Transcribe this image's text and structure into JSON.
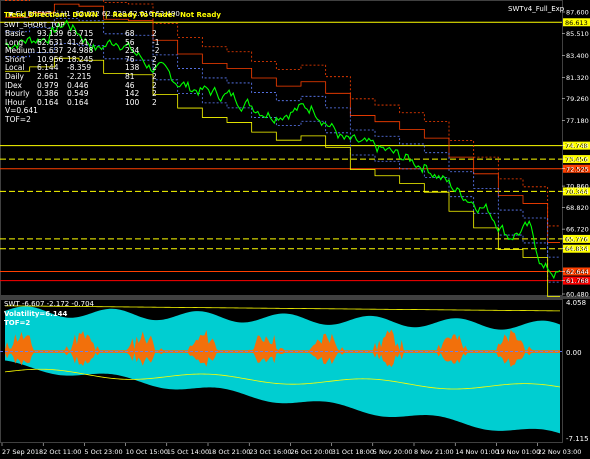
{
  "header": {
    "symbol_line": "CL_BRENT.oi,H1  62.022 62.528 62.016 62.490",
    "trend_line": "Trend Direction:  DOWN   |  Ready To Trade:  Not Ready",
    "indicator_name": "SWTv4_Full_Exp",
    "overlay_title": "SWT_SHORT_TOP"
  },
  "info_table": [
    {
      "label": "Basic",
      "v1": "93.139",
      "v2": "63.715",
      "n": "68",
      "d": "2"
    },
    {
      "label": "Long",
      "v1": "62.631",
      "v2": "41.417",
      "n": "56",
      "d": "-1"
    },
    {
      "label": "Medium",
      "v1": "15.637",
      "v2": "24.988",
      "n": "234",
      "d": "-2"
    },
    {
      "label": "Short",
      "v1": "10.956",
      "v2": "18.245",
      "n": "76",
      "d": "2"
    },
    {
      "label": "Local",
      "v1": "6.144",
      "v2": "-8.359",
      "n": "138",
      "d": "2"
    },
    {
      "label": "Daily",
      "v1": "2.661",
      "v2": "-2.215",
      "n": "81",
      "d": "2"
    },
    {
      "label": "IDex",
      "v1": "0.979",
      "v2": "0.446",
      "n": "46",
      "d": "2"
    },
    {
      "label": "Hourly",
      "v1": "0.386",
      "v2": "0.549",
      "n": "142",
      "d": "2"
    },
    {
      "label": "IHour",
      "v1": "0.164",
      "v2": "0.164",
      "n": "100",
      "d": "2"
    }
  ],
  "info_extra": [
    "V=0.641",
    "TOF=2"
  ],
  "price_axis": [
    "87.600",
    "85.510",
    "83.400",
    "81.320",
    "79.260",
    "77.180",
    "74.748",
    "73.456",
    "72.525",
    "70.860",
    "70.344",
    "68.820",
    "66.720",
    "65.776",
    "64.834",
    "62.644",
    "61.768",
    "60.480"
  ],
  "price_labels": [
    {
      "text": "86.613",
      "color": "#ffff00",
      "text_color": "#000000"
    },
    {
      "text": "74.748",
      "color": "#ffff00",
      "text_color": "#000000"
    },
    {
      "text": "73.456",
      "color": "#ffff00",
      "text_color": "#000000"
    },
    {
      "text": "72.525",
      "color": "#ff4000",
      "text_color": "#000000"
    },
    {
      "text": "70.344",
      "color": "#ffff00",
      "text_color": "#000000"
    },
    {
      "text": "65.776",
      "color": "#ffff00",
      "text_color": "#000000"
    },
    {
      "text": "64.834",
      "color": "#ffff00",
      "text_color": "#000000"
    },
    {
      "text": "62.644",
      "color": "#ff4000",
      "text_color": "#000000"
    },
    {
      "text": "61.768",
      "color": "#ff0000",
      "text_color": "#000000"
    }
  ],
  "subwindow": {
    "title": "SWT -6.607 -2.172 -0.704",
    "volatility": "Volatility=6.144",
    "tof": "TOF=2",
    "axis_top": "4.058",
    "axis_zero": "0.00",
    "axis_bottom": "-7.115"
  },
  "time_axis": [
    "27 Sep 2018",
    "2 Oct 11:00",
    "5 Oct 23:00",
    "10 Oct 15:00",
    "15 Oct 14:00",
    "18 Oct 21:00",
    "23 Oct 16:00",
    "26 Oct 20:00",
    "31 Oct 18:00",
    "5 Nov 20:00",
    "8 Nov 21:00",
    "14 Nov 01:00",
    "19 Nov 01:00",
    "22 Nov 03:00"
  ],
  "colors": {
    "price": "#00ff00",
    "resistance": "#ff4000",
    "support": "#ffff00",
    "band": "#00e0ff",
    "fill_cyan": "#00ced1",
    "fill_orange": "#ff6a00"
  }
}
